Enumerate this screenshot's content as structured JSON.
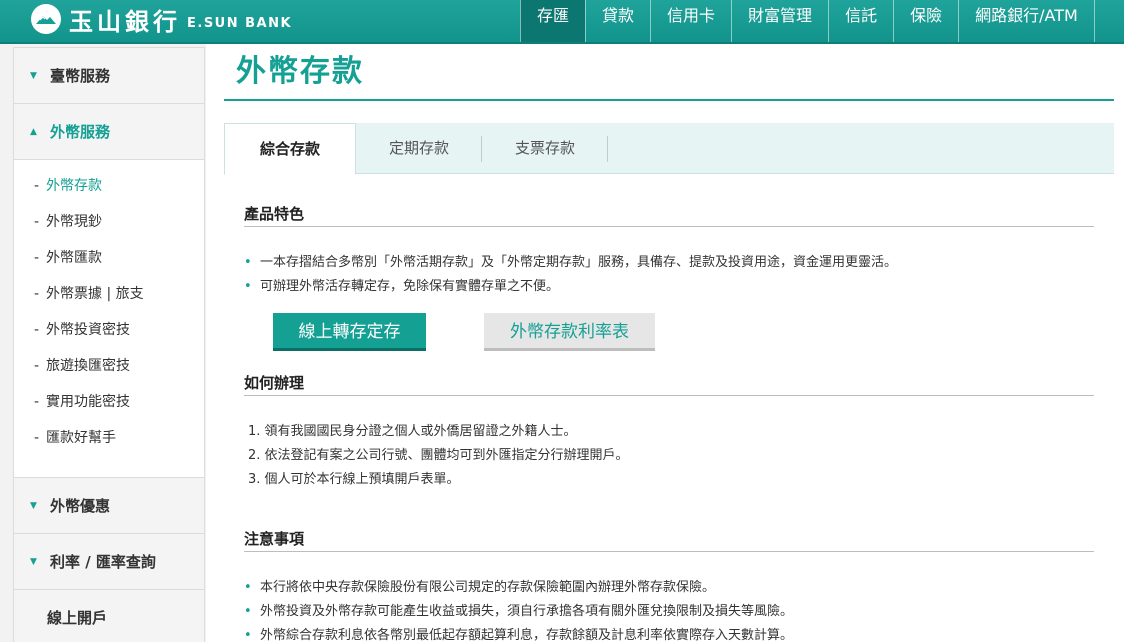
{
  "header": {
    "logo_cn": "玉山銀行",
    "logo_en": "E.SUN BANK",
    "nav": [
      "存匯",
      "貸款",
      "信用卡",
      "財富管理",
      "信託",
      "保險",
      "網路銀行/ATM"
    ],
    "nav_active": 0
  },
  "sidebar": {
    "sections": [
      {
        "label": "臺幣服務",
        "state": "collapsed"
      },
      {
        "label": "外幣服務",
        "state": "open"
      }
    ],
    "sub_items": [
      "外幣存款",
      "外幣現鈔",
      "外幣匯款",
      "外幣票據 | 旅支",
      "外幣投資密技",
      "旅遊換匯密技",
      "實用功能密技",
      "匯款好幫手"
    ],
    "sub_active": 0,
    "bottom_sections": [
      {
        "label": "外幣優惠",
        "state": "collapsed"
      },
      {
        "label": "利率 / 匯率查詢",
        "state": "collapsed"
      },
      {
        "label": "線上開戶",
        "state": "plain"
      }
    ]
  },
  "main": {
    "title": "外幣存款",
    "tabs": [
      "綜合存款",
      "定期存款",
      "支票存款"
    ],
    "active_tab": 0,
    "features": {
      "title": "產品特色",
      "items": [
        "一本存摺結合多幣別「外幣活期存款」及「外幣定期存款」服務，具備存、提款及投資用途，資金運用更靈活。",
        "可辦理外幣活存轉定存，免除保有實體存單之不便。"
      ]
    },
    "buttons": {
      "primary": "線上轉存定存",
      "secondary": "外幣存款利率表"
    },
    "howto": {
      "title": "如何辦理",
      "items": [
        "1. 領有我國國民身分證之個人或外僑居留證之外籍人士。",
        "2. 依法登記有案之公司行號、團體均可到外匯指定分行辦理開戶。",
        "3. 個人可於本行線上預填開戶表單。"
      ]
    },
    "notes": {
      "title": "注意事項",
      "items": [
        "本行將依中央存款保險股份有限公司規定的存款保險範圍內辦理外幣存款保險。",
        "外幣投資及外幣存款可能產生收益或損失，須自行承擔各項有關外匯兌換限制及損失等風險。",
        "外幣綜合存款利息依各幣別最低起存額起算利息，存款餘額及計息利率依實際存入天數計算。"
      ]
    }
  },
  "colors": {
    "brand": "#15a094",
    "nav_active": "#0c7770"
  }
}
